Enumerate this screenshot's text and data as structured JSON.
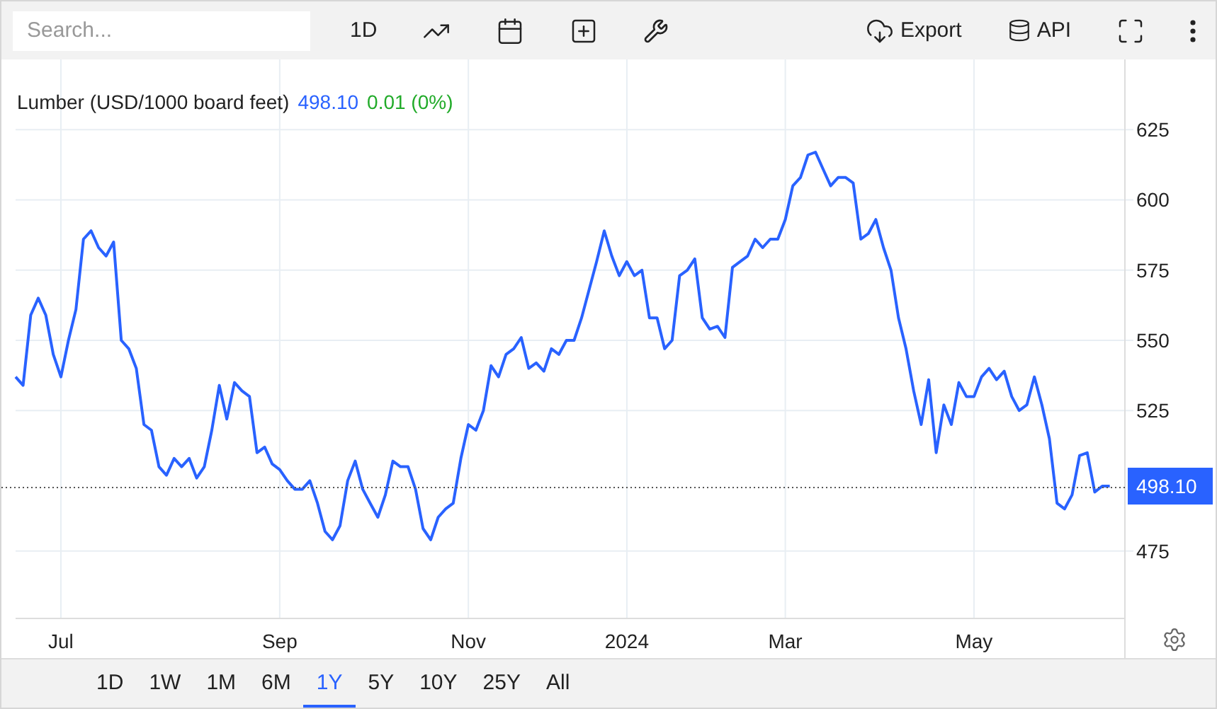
{
  "toolbar": {
    "search": {
      "placeholder": "Search..."
    },
    "interval": "1D",
    "export": "Export",
    "api": "API"
  },
  "legend": {
    "price": "498.10",
    "change": "0.01 (0%)"
  },
  "chart_data": {
    "type": "line",
    "grid": true,
    "ylim": [
      451,
      650
    ],
    "yticks": [
      475,
      525,
      550,
      575,
      600,
      625,
      {
        "value": 498.1,
        "label": "498.10"
      }
    ],
    "categories": [
      null,
      null,
      null,
      null,
      null,
      null,
      "Jul",
      null,
      null,
      null,
      null,
      null,
      null,
      null,
      null,
      null,
      null,
      null,
      null,
      null,
      null,
      null,
      null,
      null,
      null,
      null,
      null,
      null,
      null,
      null,
      null,
      null,
      null,
      null,
      null,
      "Sep",
      null,
      null,
      null,
      null,
      null,
      null,
      null,
      null,
      null,
      null,
      null,
      null,
      null,
      null,
      null,
      null,
      null,
      null,
      null,
      null,
      null,
      null,
      null,
      null,
      "Nov",
      null,
      null,
      null,
      null,
      null,
      null,
      null,
      null,
      null,
      null,
      null,
      null,
      null,
      null,
      null,
      null,
      null,
      null,
      null,
      null,
      "2024",
      null,
      null,
      null,
      null,
      null,
      null,
      null,
      null,
      null,
      null,
      null,
      null,
      null,
      null,
      null,
      null,
      null,
      null,
      null,
      null,
      "Mar",
      null,
      null,
      null,
      null,
      null,
      null,
      null,
      null,
      null,
      null,
      null,
      null,
      null,
      null,
      null,
      null,
      null,
      null,
      null,
      null,
      null,
      null,
      null,
      null,
      "May",
      null,
      null,
      null,
      null,
      null,
      null,
      null,
      null,
      null,
      null,
      null,
      null,
      null,
      null,
      null,
      null,
      null,
      null
    ],
    "series": [
      {
        "name": "Lumber (USD/1000 board feet)",
        "color": "#2962ff",
        "values": [
          537,
          534,
          559,
          565,
          559,
          545,
          537,
          550,
          561,
          586,
          589,
          583,
          580,
          585,
          550,
          547,
          540,
          520,
          518,
          505,
          502,
          508,
          505,
          508,
          501,
          505,
          518,
          534,
          522,
          535,
          532,
          530,
          510,
          512,
          506,
          504,
          500,
          497,
          497,
          500,
          492,
          482,
          479,
          484,
          500,
          507,
          497,
          492,
          487,
          495,
          507,
          505,
          505,
          497,
          483,
          479,
          487,
          490,
          492,
          508,
          520,
          518,
          525,
          541,
          537,
          545,
          547,
          551,
          540,
          542,
          539,
          547,
          545,
          550,
          550,
          558,
          568,
          578,
          589,
          580,
          573,
          578,
          573,
          575,
          558,
          558,
          547,
          550,
          573,
          575,
          579,
          558,
          554,
          555,
          551,
          576,
          578,
          580,
          586,
          583,
          586,
          586,
          593,
          605,
          608,
          616,
          617,
          611,
          605,
          608,
          608,
          606,
          586,
          588,
          593,
          583,
          575,
          558,
          547,
          532,
          520,
          536,
          510,
          527,
          520,
          535,
          530,
          530,
          537,
          540,
          536,
          539,
          530,
          525,
          527,
          537,
          527,
          515,
          492,
          490,
          495,
          509,
          510,
          496,
          498.1,
          498.1
        ]
      }
    ]
  },
  "ranges": [
    {
      "label": "1D",
      "selected": false
    },
    {
      "label": "1W",
      "selected": false
    },
    {
      "label": "1M",
      "selected": false
    },
    {
      "label": "6M",
      "selected": false
    },
    {
      "label": "1Y",
      "selected": true
    },
    {
      "label": "5Y",
      "selected": false
    },
    {
      "label": "10Y",
      "selected": false
    },
    {
      "label": "25Y",
      "selected": false
    },
    {
      "label": "All",
      "selected": false
    }
  ]
}
